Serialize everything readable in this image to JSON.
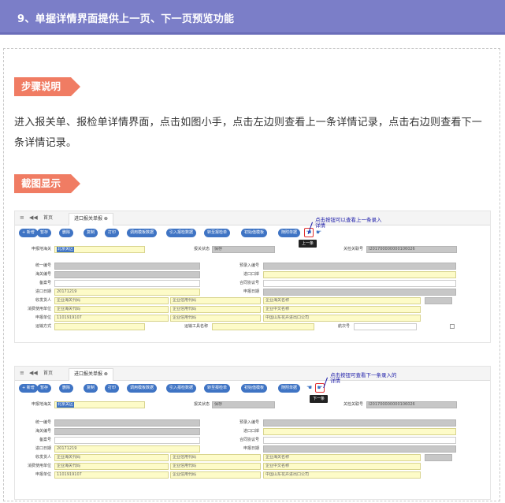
{
  "header": {
    "title": "9、单据详情界面提供上一页、下一页预览功能"
  },
  "sections": {
    "steps_label": "步骤说明",
    "steps_text": "进入报关单、报检单详情界面，点击如图小手，点击左边则查看上一条详情记录，点击右边则查看下一条详情记录。",
    "screens_label": "截图显示"
  },
  "screenshot_common": {
    "tabs": {
      "home": "首页",
      "active": "进口报关单报 ⊗"
    },
    "toolbar": [
      "+ 新增",
      "暂存",
      "删除",
      "复制",
      "打印",
      "调用模板数据",
      "引入报检数据",
      "转至报检单",
      "初始值模板",
      "随附单据"
    ],
    "form": {
      "row0": {
        "l1": "申报地海关",
        "v1": "北京关区",
        "l2": "报关状态",
        "v2": "保存",
        "l3": "关检关联号",
        "v3": "I201700000000106026"
      },
      "labels_left": [
        "统一编号",
        "海关编号",
        "备案号",
        "进口日期",
        "收发货人",
        "消费使用单位",
        "申报单位",
        "运输方式"
      ],
      "labels_mid": [
        "预录入编号",
        "进口口岸",
        "合同协议号",
        "申报日期",
        "",
        "",
        "",
        "运输工具名称"
      ],
      "date_value": "20171219",
      "decl_unit_code": "1101919107",
      "hint_hg": "企业海关代码",
      "hint_xy": "企业信用代码",
      "hint_name": "企业海关名称",
      "hint_cn": "企业中文名称",
      "company_name": "中国山东花卉进出口公司",
      "voyage_label": "航次号"
    }
  },
  "screen1": {
    "annotation_line1": "点击按钮可以查看上一条录入",
    "annotation_line2": "详情",
    "tooltip": "上一条"
  },
  "screen2": {
    "annotation_line1": "点击按钮可查看下一条录入的",
    "annotation_line2": "详情",
    "tooltip": "下一条"
  },
  "colors": {
    "header": "#7b7ec8",
    "tag": "#f07c63",
    "toolbar_button": "#3f74c4"
  }
}
